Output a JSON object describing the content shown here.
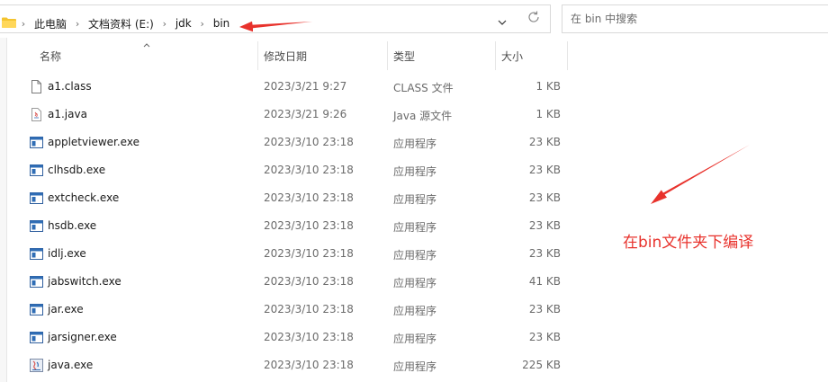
{
  "address_bar": {
    "breadcrumbs": [
      "此电脑",
      "文档资料 (E:)",
      "jdk",
      "bin"
    ]
  },
  "search": {
    "placeholder": "在 bin 中搜索"
  },
  "columns": {
    "name": "名称",
    "modified": "修改日期",
    "type": "类型",
    "size": "大小"
  },
  "files": [
    {
      "name": "a1.class",
      "modified": "2023/3/21 9:27",
      "type": "CLASS 文件",
      "size": "1 KB",
      "icon": "file-icon"
    },
    {
      "name": "a1.java",
      "modified": "2023/3/21 9:26",
      "type": "Java 源文件",
      "size": "1 KB",
      "icon": "java-file-icon"
    },
    {
      "name": "appletviewer.exe",
      "modified": "2023/3/10 23:18",
      "type": "应用程序",
      "size": "23 KB",
      "icon": "exe-icon"
    },
    {
      "name": "clhsdb.exe",
      "modified": "2023/3/10 23:18",
      "type": "应用程序",
      "size": "23 KB",
      "icon": "exe-icon"
    },
    {
      "name": "extcheck.exe",
      "modified": "2023/3/10 23:18",
      "type": "应用程序",
      "size": "23 KB",
      "icon": "exe-icon"
    },
    {
      "name": "hsdb.exe",
      "modified": "2023/3/10 23:18",
      "type": "应用程序",
      "size": "23 KB",
      "icon": "exe-icon"
    },
    {
      "name": "idlj.exe",
      "modified": "2023/3/10 23:18",
      "type": "应用程序",
      "size": "23 KB",
      "icon": "exe-icon"
    },
    {
      "name": "jabswitch.exe",
      "modified": "2023/3/10 23:18",
      "type": "应用程序",
      "size": "41 KB",
      "icon": "exe-icon"
    },
    {
      "name": "jar.exe",
      "modified": "2023/3/10 23:18",
      "type": "应用程序",
      "size": "23 KB",
      "icon": "exe-icon"
    },
    {
      "name": "jarsigner.exe",
      "modified": "2023/3/10 23:18",
      "type": "应用程序",
      "size": "23 KB",
      "icon": "exe-icon"
    },
    {
      "name": "java.exe",
      "modified": "2023/3/10 23:18",
      "type": "应用程序",
      "size": "225 KB",
      "icon": "java-exe-icon"
    }
  ],
  "annotation": {
    "text": "在bin文件夹下编译",
    "color": "#e8322c"
  }
}
